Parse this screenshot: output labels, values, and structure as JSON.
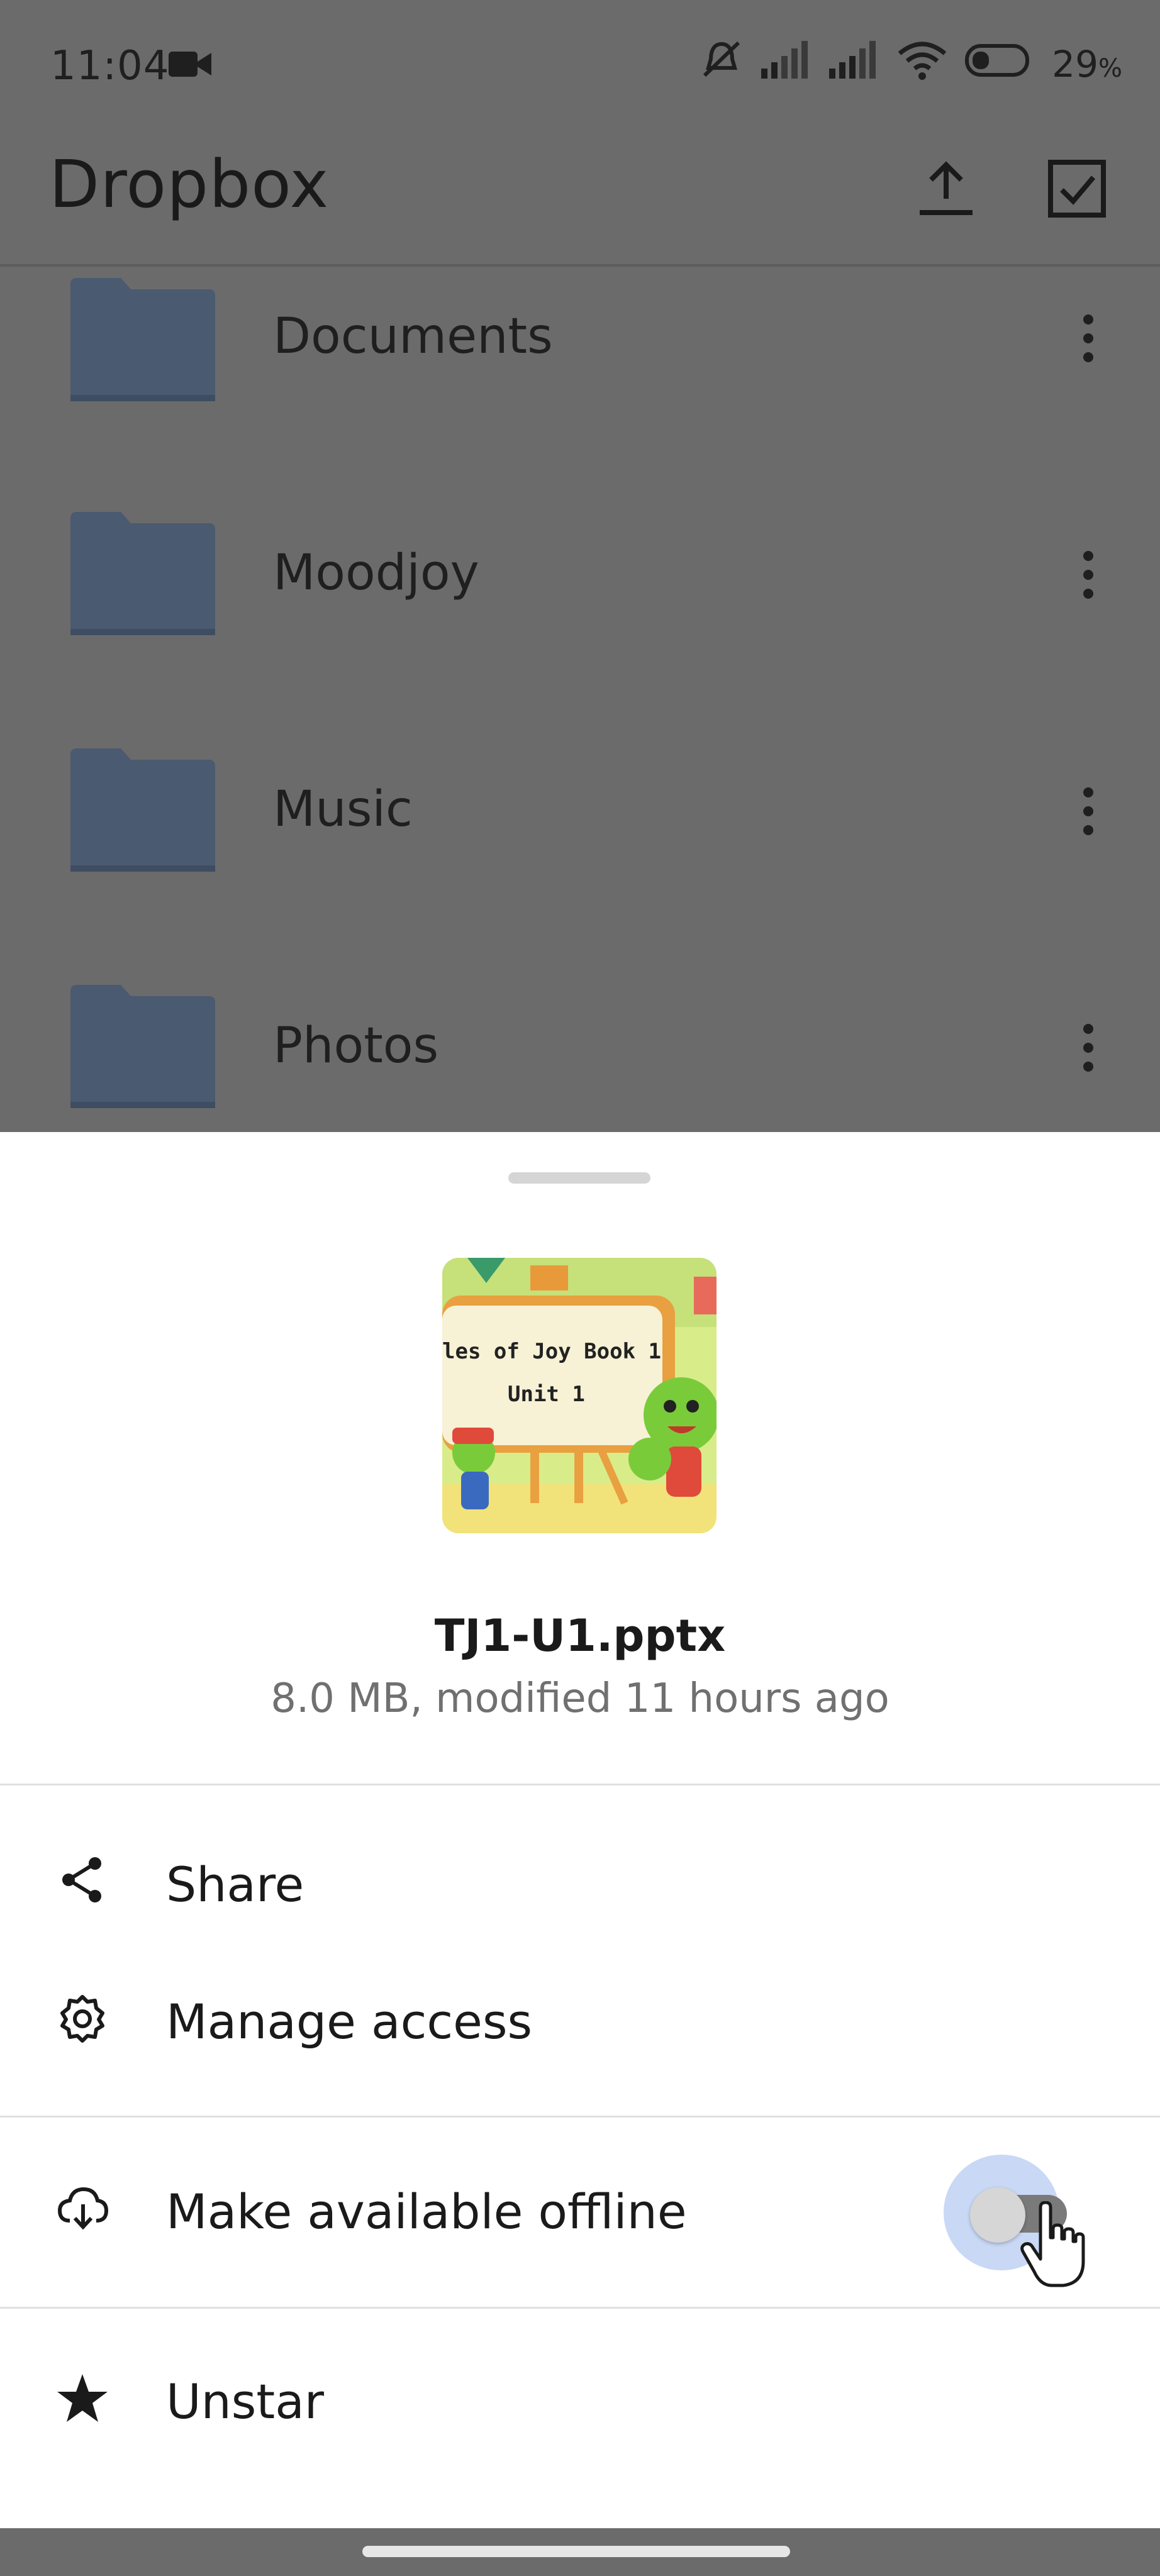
{
  "status_bar": {
    "time": "11:04",
    "battery": "29",
    "battery_unit": "%"
  },
  "app_bar": {
    "title": "Dropbox",
    "upload_icon": "upload-icon",
    "select_icon": "checkbox-icon"
  },
  "folders": [
    {
      "name": "Documents"
    },
    {
      "name": "Moodjoy"
    },
    {
      "name": "Music"
    },
    {
      "name": "Photos"
    }
  ],
  "sheet": {
    "thumbnail_line1": "les of Joy Book 1",
    "thumbnail_line2": "Unit 1",
    "file_name": "TJ1-U1.pptx",
    "file_meta": "8.0 MB, modified 11 hours ago",
    "actions": [
      {
        "label": "Share",
        "icon": "share-icon"
      },
      {
        "label": "Manage access",
        "icon": "gear-icon"
      },
      {
        "label": "Make available offline",
        "icon": "cloud-download-icon",
        "toggle_on": false
      },
      {
        "label": "Unstar",
        "icon": "star-icon"
      }
    ]
  },
  "colors": {
    "scrim": "#6b6b6b",
    "folder": "#4a5a70",
    "sheet_bg": "#ffffff",
    "toggle_halo": "#c8d8f5"
  }
}
